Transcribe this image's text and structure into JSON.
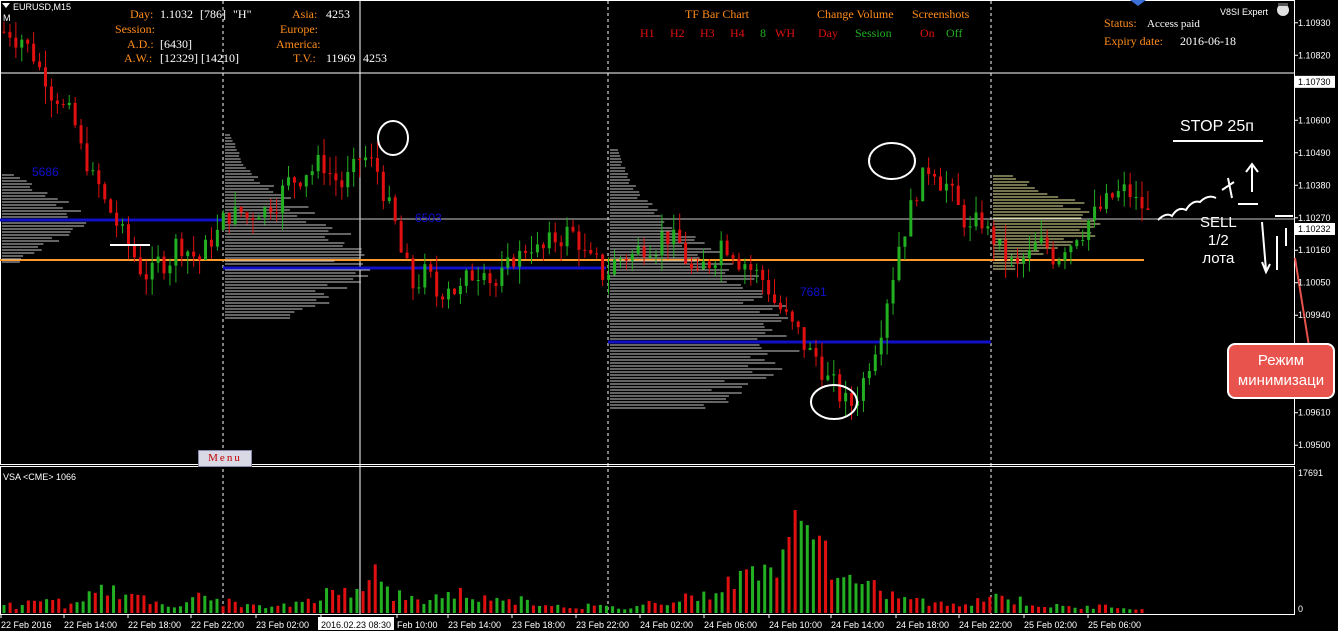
{
  "window": {
    "symbol": "EURUSD,M15",
    "sub_label": "M"
  },
  "info_panel": {
    "day_label": "Day:",
    "day_value": "1.1032",
    "day_count": "[786]",
    "day_flag": "\"H\"",
    "session_label": "Session:",
    "ad_label": "A.D.:",
    "ad_value": "[6430]",
    "aw_label": "A.W.:",
    "aw_value": "[12329] [14210]",
    "asia_label": "Asia:",
    "asia_value": "4253",
    "europe_label": "Europe:",
    "america_label": "America:",
    "tv_label": "T.V.:",
    "tv_value1": "11969",
    "tv_value2": "4253"
  },
  "toolbar": {
    "tf_title": "TF Bar Chart",
    "tf_items": [
      "H1",
      "H2",
      "H3",
      "H4",
      "8",
      "WH"
    ],
    "cv_title": "Change Volume",
    "cv_day": "Day",
    "cv_session": "Session",
    "ss_title": "Screenshots",
    "ss_on": "On",
    "ss_off": "Off"
  },
  "status": {
    "status_label": "Status:",
    "status_value": "Access paid",
    "expiry_label": "Expiry date:",
    "expiry_value": "2016-06-18",
    "expert": "V8SI Expert"
  },
  "price_axis": {
    "labels": [
      "1.10930",
      "1.10820",
      "1.10730",
      "1.10600",
      "1.10490",
      "1.10380",
      "1.10270",
      "1.10232",
      "1.10160",
      "1.10050",
      "1.09940",
      "1.09830",
      "1.09610",
      "1.09500"
    ],
    "current_price": "1.10232",
    "highlight_price": "1.10730"
  },
  "volume_axis": {
    "max": "17691",
    "min": "0"
  },
  "volume_panel": {
    "title": "VSA <CME> 1066"
  },
  "time_axis": {
    "labels": [
      "22 Feb 2016",
      "22 Feb 14:00",
      "22 Feb 18:00",
      "22 Feb 22:00",
      "23 Feb 02:00",
      "2016.02.23 08:30",
      "Feb 10:00",
      "23 Feb 14:00",
      "23 Feb 18:00",
      "23 Feb 22:00",
      "24 Feb 02:00",
      "24 Feb 06:00",
      "24 Feb 10:00",
      "24 Feb 14:00",
      "24 Feb 18:00",
      "24 Feb 22:00",
      "25 Feb 02:00",
      "25 Feb 06:00"
    ]
  },
  "profile_labels": {
    "a": "5686",
    "b": "6503",
    "c": "7681"
  },
  "menu_label": "Menu",
  "annotations": {
    "stop": "STOP 25п",
    "sell_l1": "SELL",
    "sell_l2": "1/2",
    "sell_l3": "лота",
    "callout_l1": "Режим",
    "callout_l2": "минимизаци"
  },
  "colors": {
    "bull": "#22b022",
    "bear": "#e01010",
    "poc": "#1010c8",
    "level": "#ff9a2a",
    "profile": "#c8c8c8",
    "profile_yellow": "#e6e69a",
    "label": "#ff8c1a",
    "vol_label": "#1010d0"
  },
  "chart_data": {
    "type": "candlestick",
    "title": "EURUSD,M15",
    "ylim": [
      1.0945,
      1.1098
    ],
    "close_path": [
      1.109,
      1.1088,
      1.1082,
      1.1075,
      1.1068,
      1.1062,
      1.105,
      1.104,
      1.1032,
      1.1025,
      1.1018,
      1.101,
      1.1008,
      1.1012,
      1.1018,
      1.1016,
      1.1013,
      1.102,
      1.1026,
      1.1028,
      1.1027,
      1.103,
      1.1032,
      1.1036,
      1.104,
      1.1043,
      1.1045,
      1.1042,
      1.1038,
      1.1043,
      1.1047,
      1.1043,
      1.103,
      1.1015,
      1.1004,
      1.1008,
      1.1001,
      1.1005,
      1.1002,
      1.1008,
      1.1012,
      1.1004,
      1.101,
      1.1014,
      1.1018,
      1.1016,
      1.102,
      1.1022,
      1.1019,
      1.1012,
      1.1008,
      1.1012,
      1.1014,
      1.1016,
      1.1018,
      1.1021,
      1.1019,
      1.1013,
      1.1006,
      1.1012,
      1.1019,
      1.1016,
      1.1012,
      1.1008,
      1.1003,
      1.0996,
      1.099,
      1.0984,
      1.098,
      1.0972,
      1.0967,
      1.0964,
      1.0972,
      1.0984,
      1.1,
      1.1018,
      1.103,
      1.104,
      1.1044,
      1.1038,
      1.103,
      1.1022,
      1.1026,
      1.102,
      1.1014,
      1.101,
      1.1014,
      1.1018,
      1.1014,
      1.1018,
      1.1022,
      1.1026,
      1.103,
      1.1034,
      1.1036,
      1.1032,
      1.1028
    ],
    "volume": [
      1200,
      900,
      1500,
      2200,
      1800,
      1100,
      1300,
      2500,
      4200,
      3100,
      2600,
      2000,
      1700,
      1500,
      1300,
      1800,
      2400,
      2000,
      1600,
      1400,
      1100,
      900,
      800,
      1200,
      1600,
      2200,
      3000,
      2800,
      3500,
      4500,
      6400,
      3800,
      2600,
      2000,
      1700,
      2400,
      2800,
      3100,
      2500,
      2200,
      1800,
      2600,
      2000,
      1700,
      1400,
      1200,
      1000,
      900,
      1100,
      900,
      800,
      700,
      1200,
      1500,
      1800,
      2200,
      2600,
      2400,
      3300,
      4100,
      5200,
      6000,
      7800,
      6600,
      8600,
      12500,
      17691,
      9800,
      6400,
      4800,
      4200,
      3600,
      3000,
      2600,
      2200,
      1800,
      1500,
      1300,
      1100,
      1700,
      2200,
      2600,
      2300,
      1900,
      1500,
      1200,
      1000,
      900,
      800,
      900,
      1000,
      1100,
      900,
      700
    ]
  }
}
